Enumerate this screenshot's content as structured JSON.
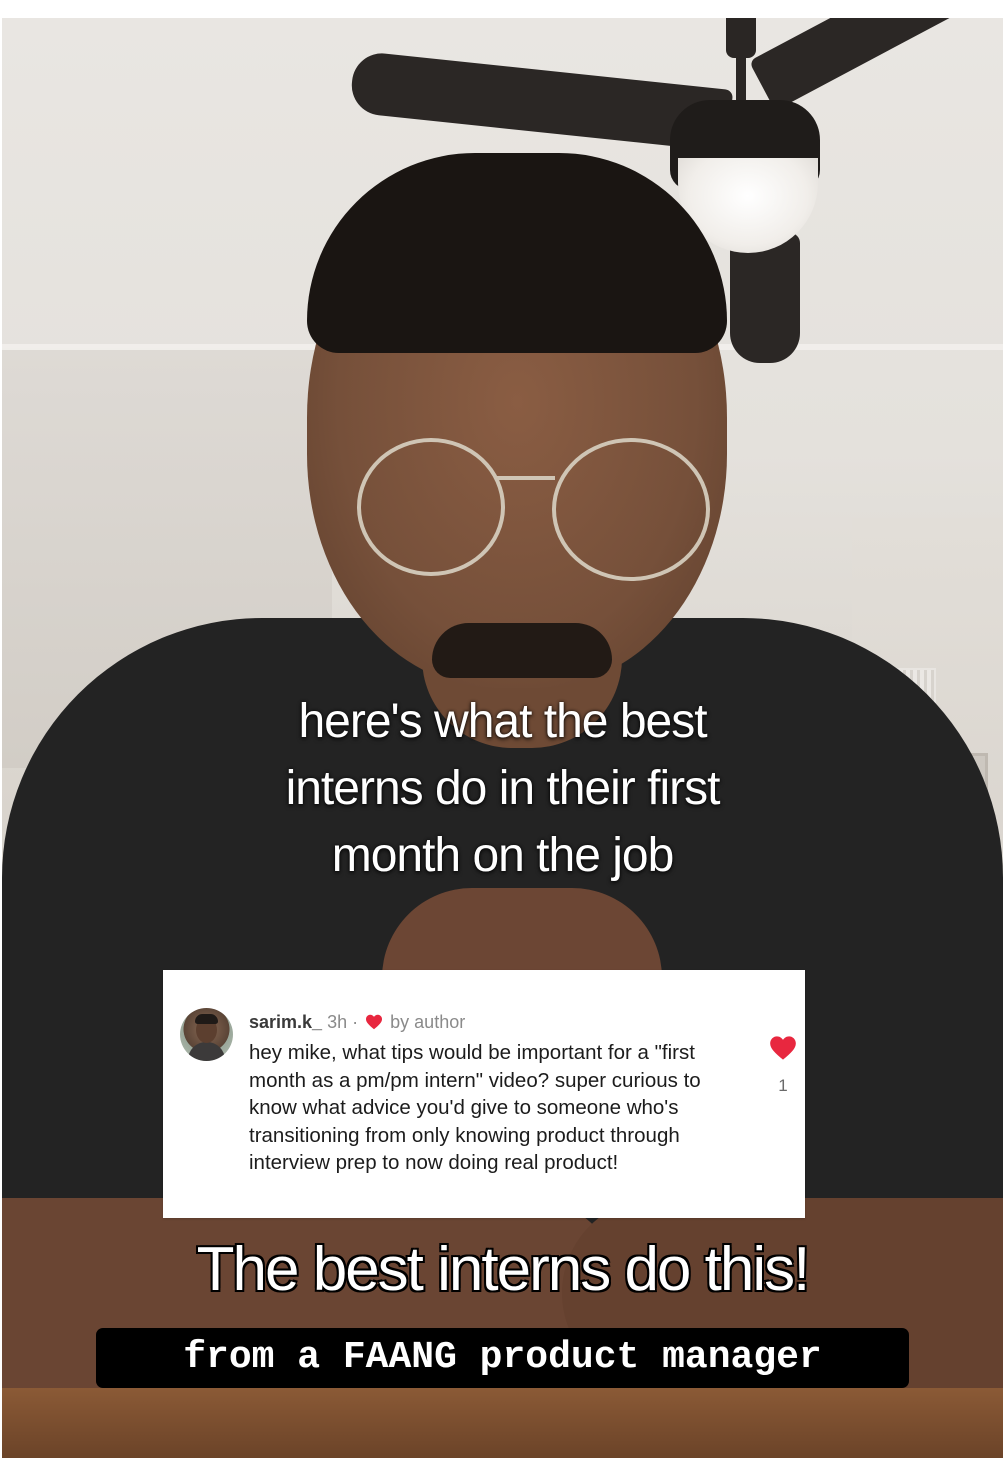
{
  "video": {
    "caption_lines": [
      "here's what the best",
      "interns do in their first",
      "month on the job"
    ],
    "title": "The best interns do this!",
    "subtitle": "from a FAANG product manager"
  },
  "reply_card": {
    "username": "sarim.k_",
    "time": "3h",
    "separator": "·",
    "liked_by": "by author",
    "comment": "hey mike, what tips would be important for a \"first month as a pm/pm intern\" video? super curious to know what advice you'd give to someone who's transitioning from only knowing product through interview prep to now doing real product!",
    "like_count": "1",
    "heart_color": "#e8273f"
  }
}
